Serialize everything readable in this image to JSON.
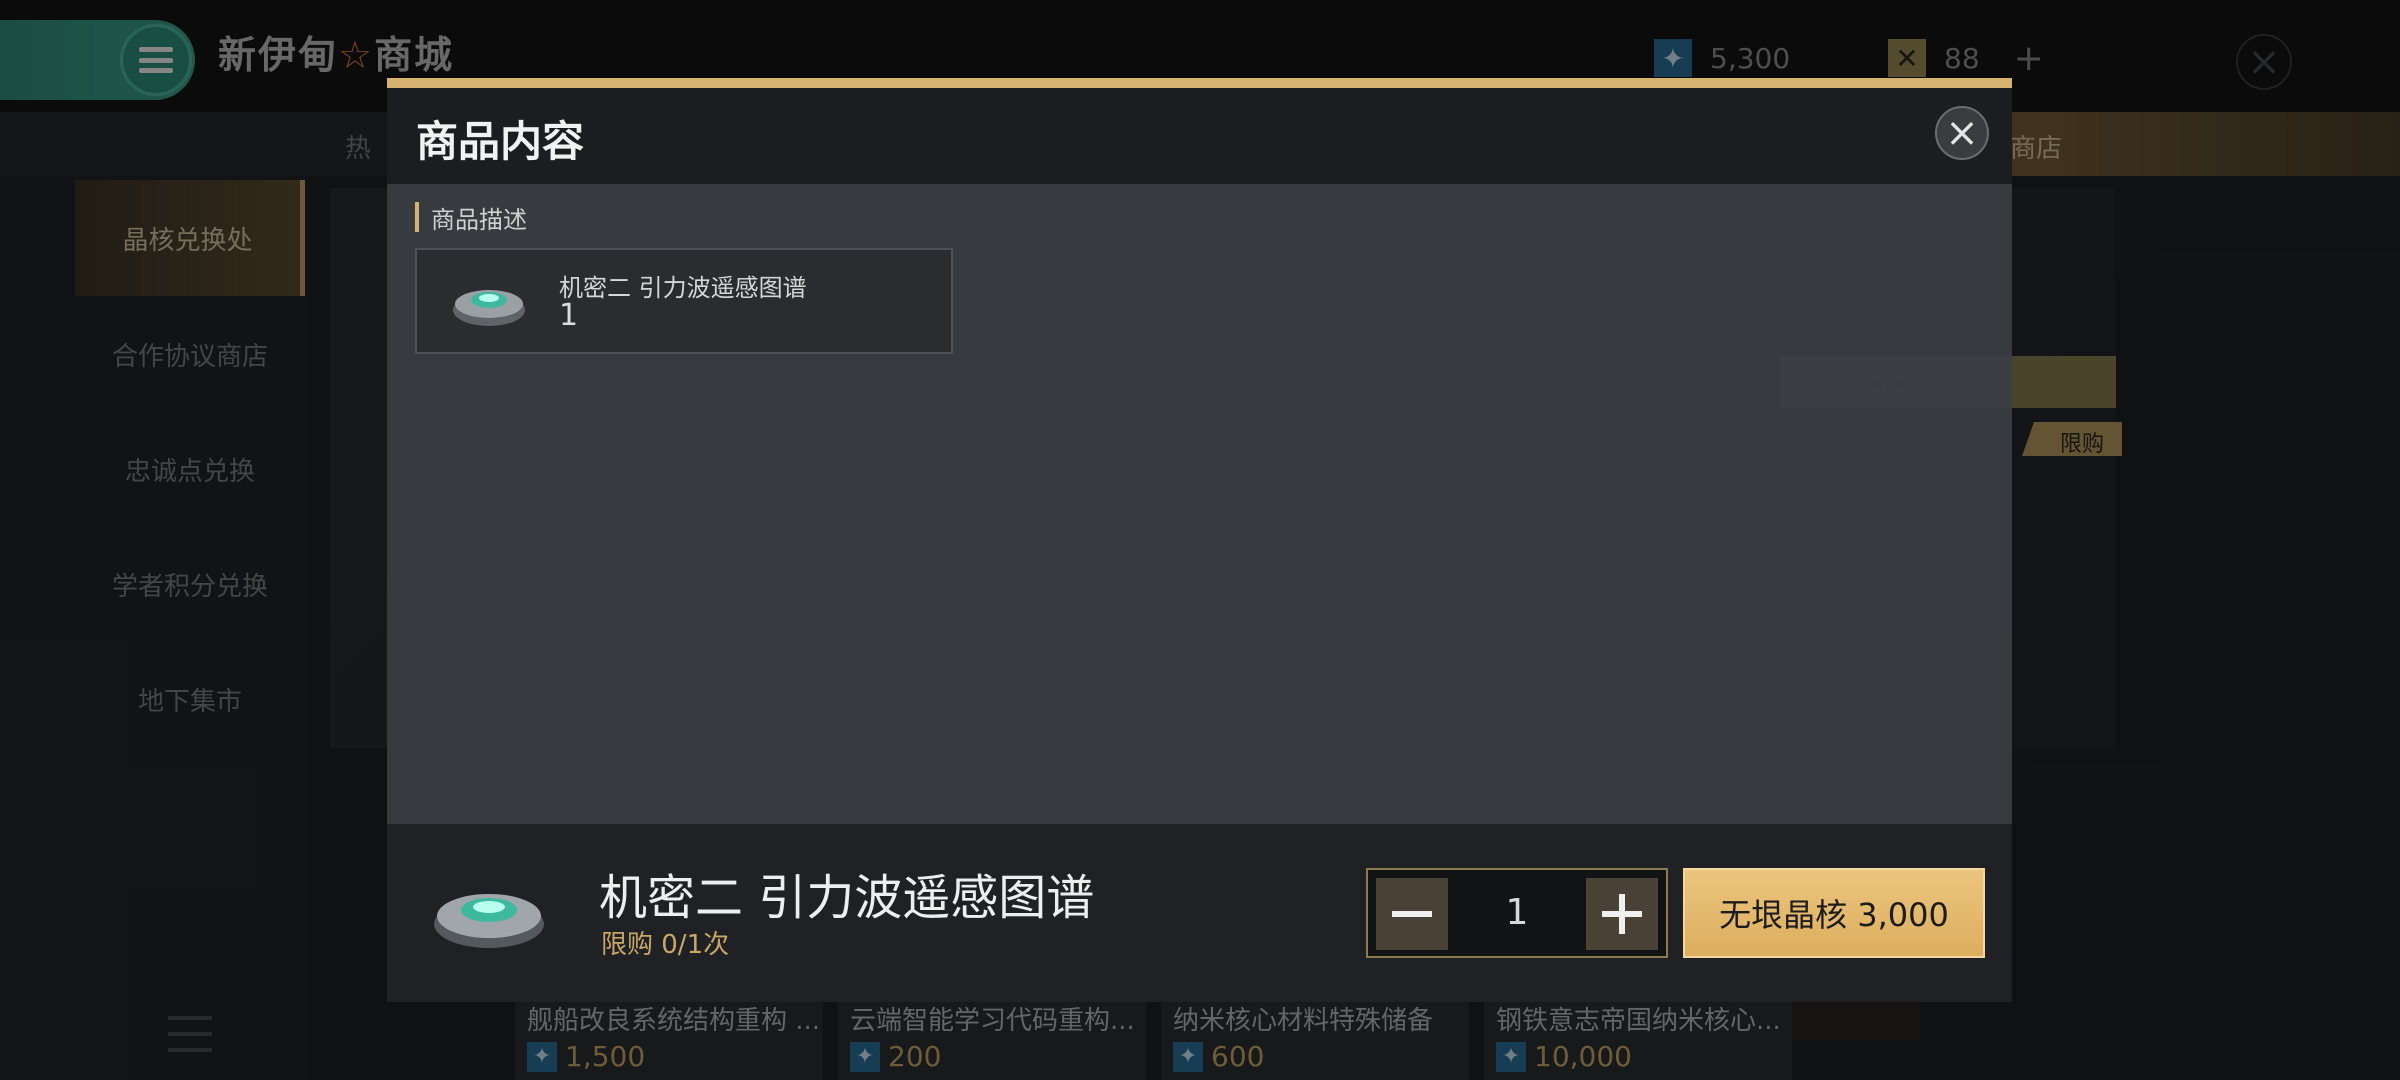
{
  "header": {
    "app_title": "新伊甸",
    "app_title_star": "☆",
    "app_title_suffix": "商城",
    "currency_crystal": {
      "icon": "crystal-star-icon",
      "value": "5,300"
    },
    "currency_gold": {
      "icon": "gold-token-icon",
      "value": "88"
    },
    "colors": {
      "accent": "#d3b36f",
      "menu": "#3aa08b"
    }
  },
  "tabs": {
    "hot_partial": "热",
    "shop_partial": "商店"
  },
  "sidebar": {
    "items": [
      {
        "label": "晶核兑换处",
        "active": true
      },
      {
        "label": "合作协议商店",
        "active": false
      },
      {
        "label": "忠诚点兑换",
        "active": false
      },
      {
        "label": "学者积分兑换",
        "active": false
      },
      {
        "label": "地下集市",
        "active": false
      }
    ]
  },
  "background": {
    "limit_tag": "限购",
    "goods": [
      {
        "name": "舰船改良系统结构重构 ...",
        "price": "1,500"
      },
      {
        "name": "云端智能学习代码重构...",
        "price": "200"
      },
      {
        "name": "纳米核心材料特殊储备",
        "price": "600"
      },
      {
        "name": "钢铁意志帝国纳米核心...",
        "price": "10,000"
      }
    ]
  },
  "modal": {
    "title": "商品内容",
    "section_label": "商品描述",
    "item": {
      "name": "机密二 引力波遥感图谱",
      "qty": "1",
      "icon": "disc-device-icon"
    },
    "footer": {
      "name": "机密二  引力波遥感图谱",
      "limit": "限购 0/1次",
      "quantity": "1",
      "buy_label": "无垠晶核 3,000"
    }
  }
}
